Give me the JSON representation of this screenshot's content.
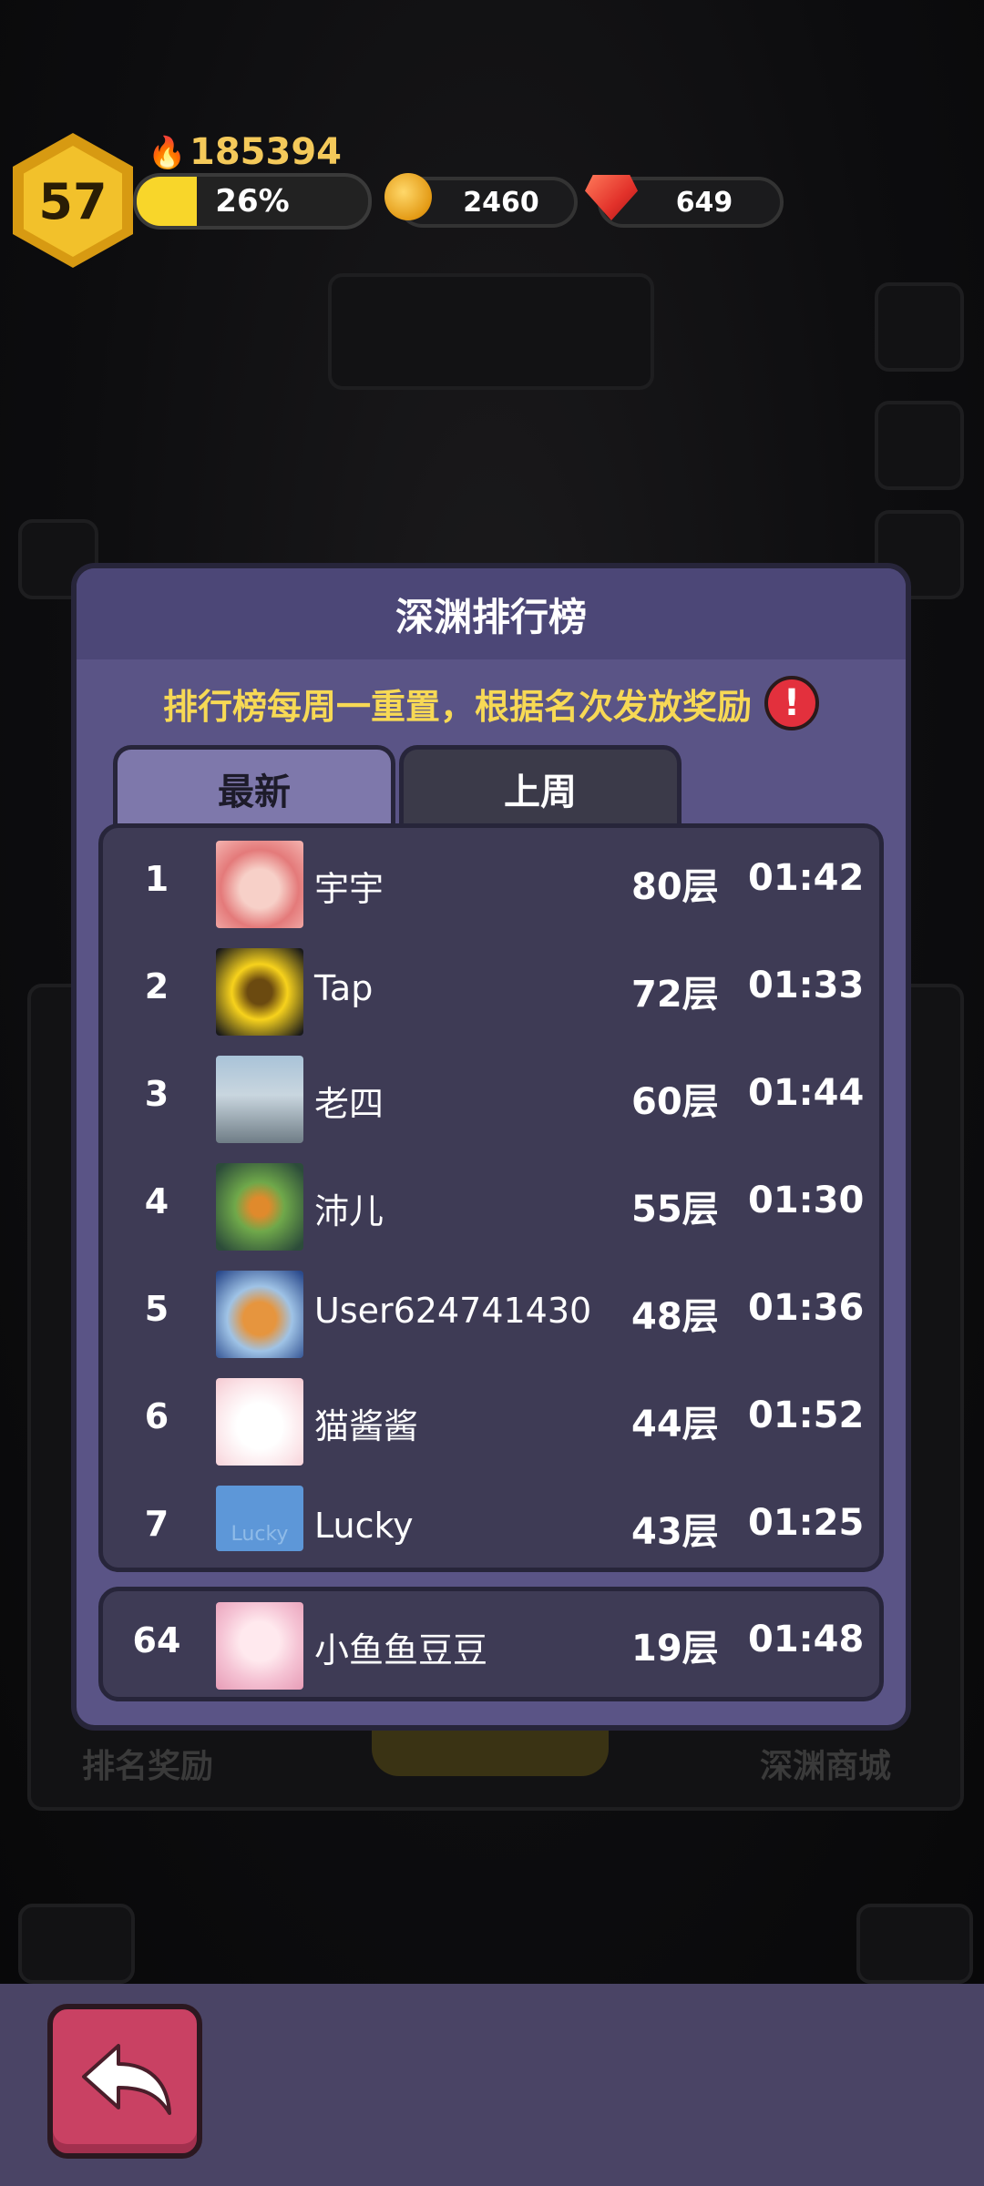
{
  "hud": {
    "level": "57",
    "power": "185394",
    "xp_percent": "26%",
    "xp_fraction": 0.26,
    "coins": "2460",
    "gems": "649"
  },
  "background": {
    "rank_reward_label": "排名奖励",
    "abyss_shop_label": "深渊商城"
  },
  "panel": {
    "title": "深渊排行榜",
    "notice": "排行榜每周一重置，根据名次发放奖励",
    "tabs": [
      {
        "label": "最新",
        "active": true
      },
      {
        "label": "上周",
        "active": false
      }
    ],
    "rows": [
      {
        "rank": "1",
        "name": "宇宇",
        "floor": "80层",
        "time": "01:42",
        "avatar": "pink-character-avatar"
      },
      {
        "rank": "2",
        "name": "Tap",
        "floor": "72层",
        "time": "01:33",
        "avatar": "gold-knight-avatar"
      },
      {
        "rank": "3",
        "name": "老四",
        "floor": "60层",
        "time": "01:44",
        "avatar": "landscape-photo-avatar"
      },
      {
        "rank": "4",
        "name": "沛儿",
        "floor": "55层",
        "time": "01:30",
        "avatar": "green-creature-avatar"
      },
      {
        "rank": "5",
        "name": "User624741430",
        "floor": "48层",
        "time": "01:36",
        "avatar": "shiba-astronaut-avatar"
      },
      {
        "rank": "6",
        "name": "猫酱酱",
        "floor": "44层",
        "time": "01:52",
        "avatar": "cute-cat-avatar"
      },
      {
        "rank": "7",
        "name": "Lucky",
        "floor": "43层",
        "time": "01:25",
        "avatar": "lucky-text-avatar"
      }
    ],
    "my_row": {
      "rank": "64",
      "name": "小鱼鱼豆豆",
      "floor": "19层",
      "time": "01:48",
      "avatar": "anime-girl-avatar"
    },
    "avatar_lucky_text": "Lucky"
  },
  "colors": {
    "panel_bg": "#5a5486",
    "accent_yellow": "#f7d955",
    "back_button": "#c94163"
  }
}
